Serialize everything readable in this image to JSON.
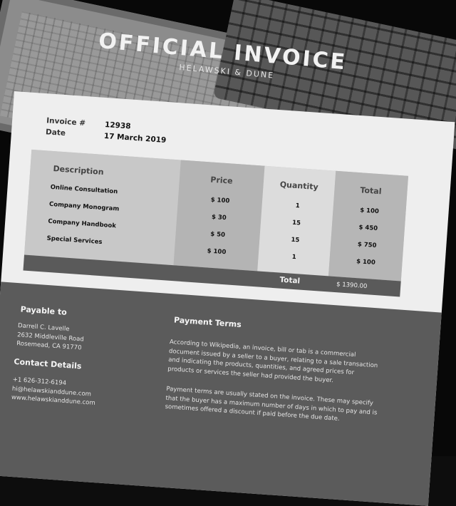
{
  "header": {
    "title": "OFFICIAL INVOICE",
    "subtitle": "HELAWSKI & DUNE"
  },
  "invoice_meta": {
    "number_label": "Invoice #",
    "number_value": "12938",
    "date_label": "Date",
    "date_value": "17 March 2019"
  },
  "table": {
    "headers": {
      "description": "Description",
      "price": "Price",
      "quantity": "Quantity",
      "total": "Total"
    },
    "rows": [
      {
        "description": "Online Consultation",
        "price": "$ 100",
        "quantity": "1",
        "total": "$ 100"
      },
      {
        "description": "Company Monogram",
        "price": "$ 30",
        "quantity": "15",
        "total": "$ 450"
      },
      {
        "description": "Company Handbook",
        "price": "$ 50",
        "quantity": "15",
        "total": "$ 750"
      },
      {
        "description": "Special Services",
        "price": "$ 100",
        "quantity": "1",
        "total": "$ 100"
      }
    ],
    "total_label": "Total",
    "total_value": "$ 1390.00"
  },
  "footer": {
    "payable_heading": "Payable to",
    "payable_lines": [
      "Darrell C. Lavelle",
      "2632 Middleville Road",
      "Rosemead, CA 91770"
    ],
    "contact_heading": "Contact Details",
    "contact_lines": [
      "+1 626-312-6194",
      "hi@helawskianddune.com",
      "www.helawskianddune.com"
    ],
    "terms_heading": "Payment Terms",
    "terms_paragraph_1": "According to Wikipedia, an invoice, bill or tab is a commercial document issued by a seller to a buyer, relating to a sale transaction and indicating the products, quantities, and agreed prices for products or services the seller had provided the buyer.",
    "terms_paragraph_2": "Payment terms are usually stated on the invoice. These may specify that the buyer has a maximum number of days in which to pay and is sometimes offered a discount if paid before the due date."
  },
  "colors": {
    "sheet": "#eeeeee",
    "footer": "#5b5b5b",
    "total_bar": "#5a5a5a"
  }
}
